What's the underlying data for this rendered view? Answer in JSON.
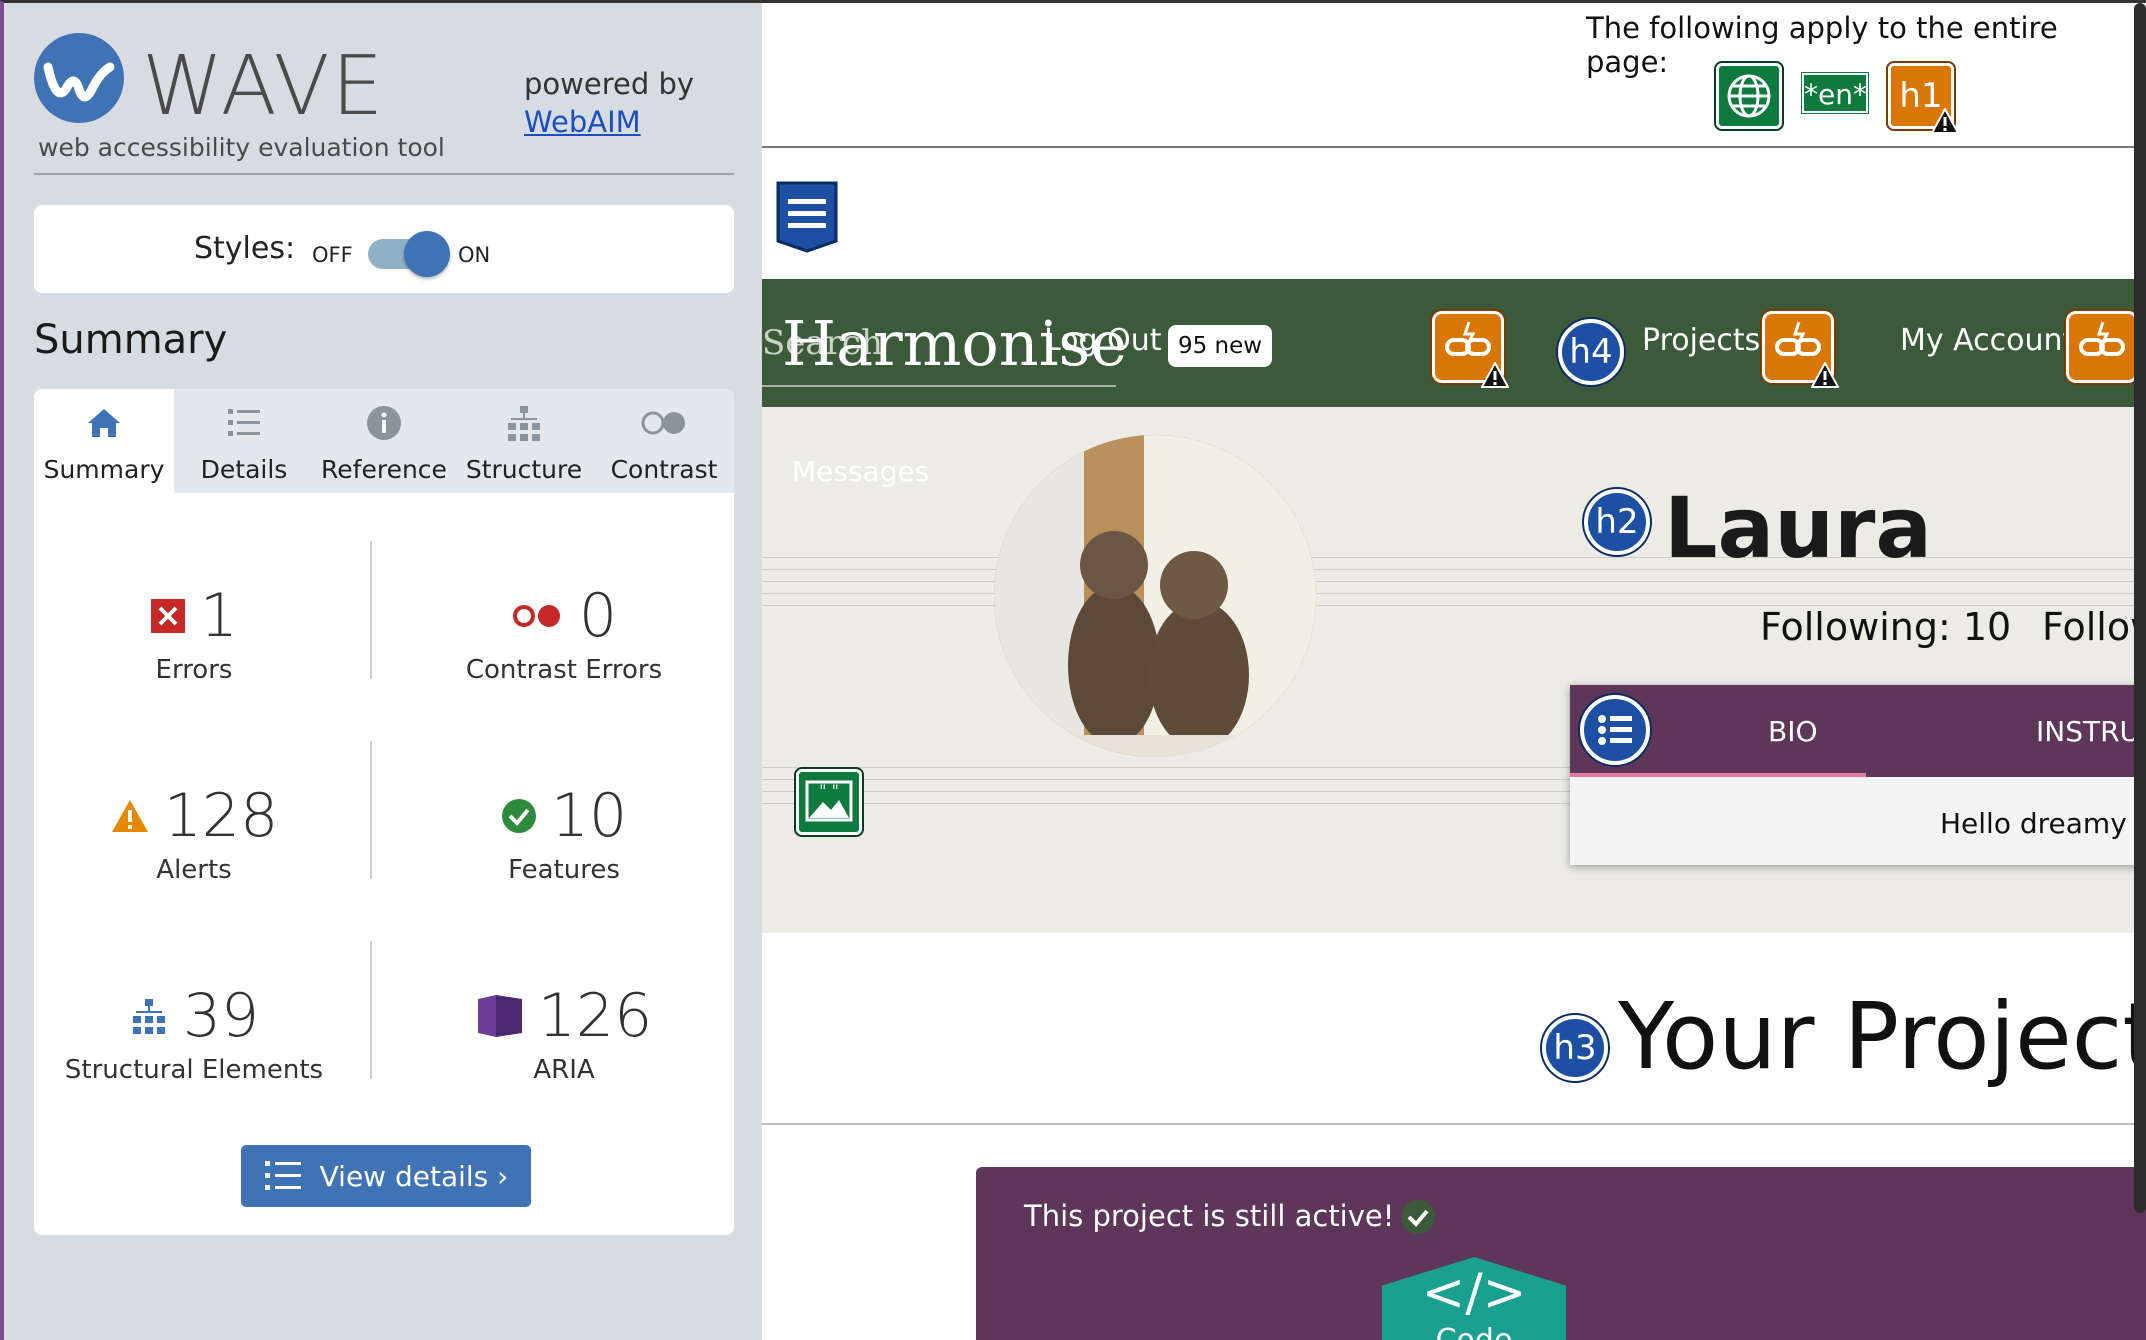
{
  "wave": {
    "logo_word": "WAVE",
    "tagline": "web accessibility evaluation tool",
    "powered_by": "powered by",
    "powered_link": "WebAIM",
    "styles_label": "Styles:",
    "styles_off": "OFF",
    "styles_on": "ON",
    "summary_heading": "Summary",
    "tabs": [
      {
        "label": "Summary",
        "icon": "home-icon",
        "active": true
      },
      {
        "label": "Details",
        "icon": "list-icon"
      },
      {
        "label": "Reference",
        "icon": "info-icon"
      },
      {
        "label": "Structure",
        "icon": "hierarchy-icon"
      },
      {
        "label": "Contrast",
        "icon": "contrast-icon"
      }
    ],
    "stats": {
      "errors": {
        "value": "1",
        "label": "Errors"
      },
      "contrast": {
        "value": "0",
        "label": "Contrast Errors"
      },
      "alerts": {
        "value": "128",
        "label": "Alerts"
      },
      "features": {
        "value": "10",
        "label": "Features"
      },
      "structure": {
        "value": "39",
        "label": "Structural Elements"
      },
      "aria": {
        "value": "126",
        "label": "ARIA"
      }
    },
    "view_details": "View details ›",
    "colors": {
      "brand": "#3f73b6",
      "error": "#c62828",
      "alert": "#e58a00",
      "feature": "#2e8b3e",
      "aria": "#6b3f98"
    }
  },
  "page": {
    "apply_text": "The following apply to the entire page:",
    "lang_badge": "*en*",
    "h1_badge": "h1",
    "search_ghost": "Search",
    "brand": "Harmonise",
    "nav": {
      "logout": "Log Out",
      "new_badge": "95 new",
      "h4_badge": "h4",
      "projects": "Projects",
      "my_account": "My Account"
    },
    "messages": "Messages",
    "h2_badge": "h2",
    "name": "Laura",
    "following": "Following: 10",
    "followers": "Follow",
    "card": {
      "tab_bio": "BIO",
      "tab_instruments": "INSTRU",
      "bio_text": "Hello dreamy is"
    },
    "h3_badge": "h3",
    "your_projects": "Your Projects",
    "project_status": "This project is still active!",
    "code_symbol": "</>",
    "code_label": "Code",
    "colors": {
      "nav_green": "#3b5a39",
      "purple": "#5d3659",
      "icon_orange": "#d97706",
      "badge_blue": "#1d4fa3"
    }
  }
}
